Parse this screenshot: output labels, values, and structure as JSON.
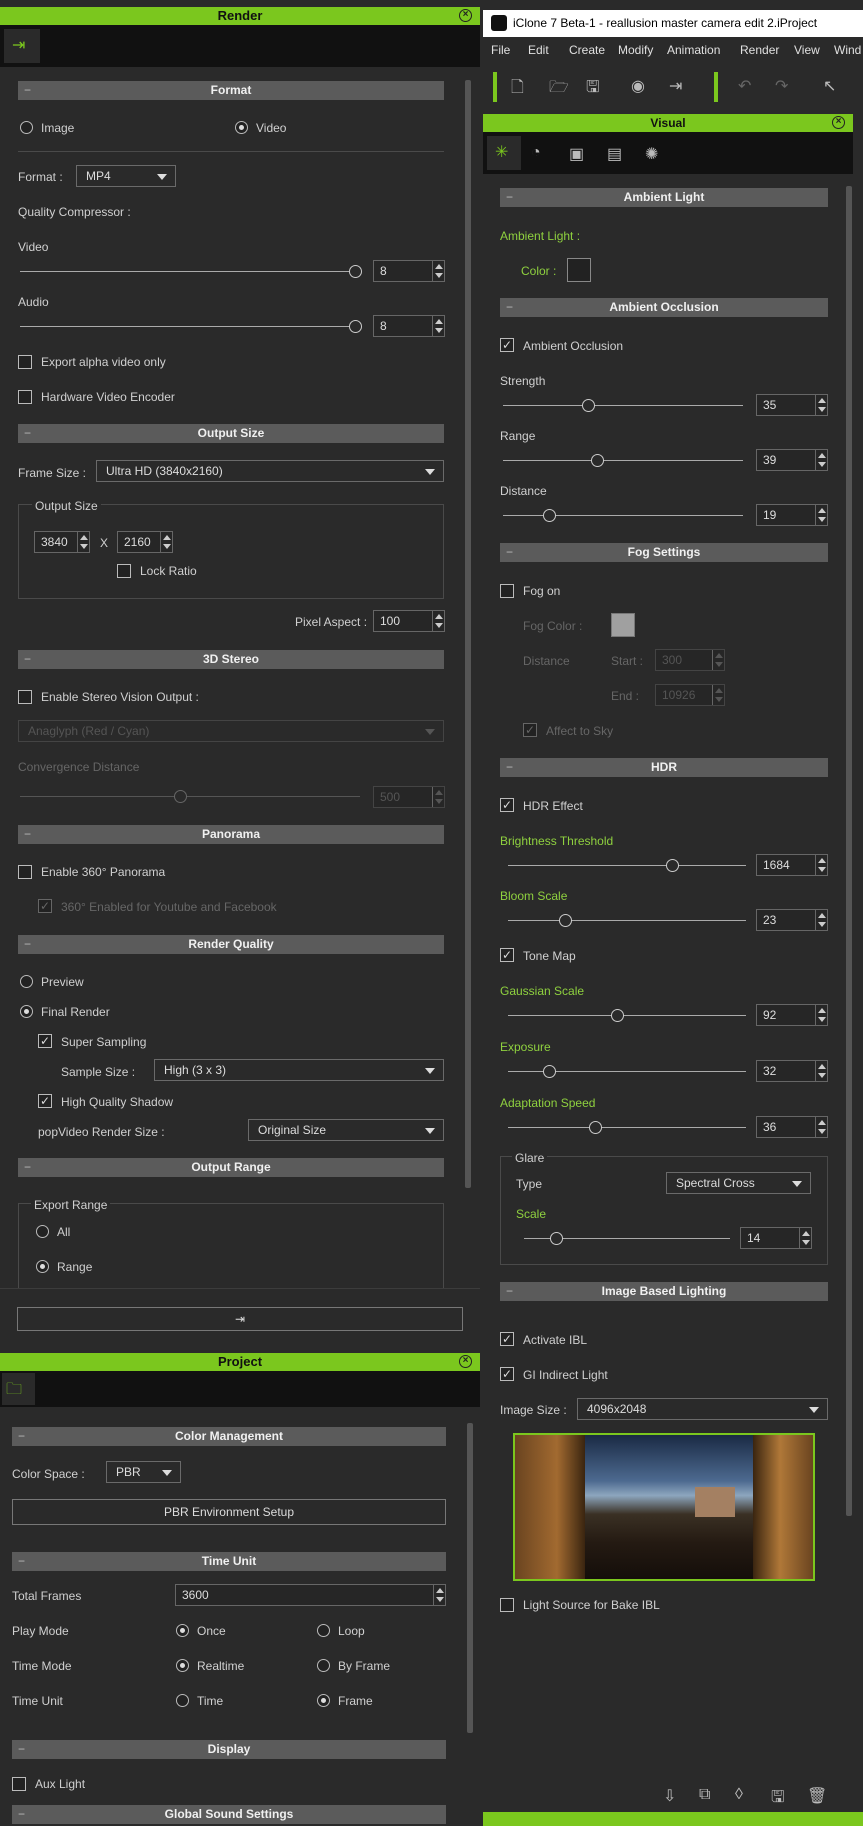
{
  "render": {
    "title": "Render",
    "format_section": "Format",
    "image_label": "Image",
    "video_label": "Video",
    "format_label": "Format :",
    "format_value": "MP4",
    "quality_label": "Quality Compressor :",
    "video_quality_label": "Video",
    "video_quality_value": "8",
    "audio_quality_label": "Audio",
    "audio_quality_value": "8",
    "export_alpha_label": "Export alpha video only",
    "hw_encoder_label": "Hardware Video Encoder",
    "output_size_section": "Output Size",
    "frame_size_label": "Frame Size :",
    "frame_size_value": "Ultra HD (3840x2160)",
    "output_size_group": "Output Size",
    "width_value": "3840",
    "x_label": "X",
    "height_value": "2160",
    "lock_ratio_label": "Lock Ratio",
    "pixel_aspect_label": "Pixel Aspect :",
    "pixel_aspect_value": "100",
    "stereo_section": "3D Stereo",
    "enable_stereo_label": "Enable Stereo Vision Output :",
    "anaglyph_value": "Anaglyph (Red / Cyan)",
    "convergence_label": "Convergence Distance",
    "convergence_value": "500",
    "panorama_section": "Panorama",
    "enable_360_label": "Enable 360° Panorama",
    "youtube_label": "360° Enabled for Youtube and Facebook",
    "render_quality_section": "Render Quality",
    "preview_label": "Preview",
    "final_render_label": "Final Render",
    "super_sampling_label": "Super Sampling",
    "sample_size_label": "Sample Size :",
    "sample_size_value": "High (3 x 3)",
    "hq_shadow_label": "High Quality Shadow",
    "popvideo_label": "popVideo Render Size :",
    "popvideo_value": "Original Size",
    "output_range_section": "Output Range",
    "export_range_group": "Export Range",
    "all_label": "All",
    "range_label": "Range",
    "render_button_icon": "⇥"
  },
  "project": {
    "title": "Project",
    "color_mgmt_section": "Color Management",
    "color_space_label": "Color Space :",
    "color_space_value": "PBR",
    "pbr_env_button": "PBR Environment Setup",
    "time_unit_section": "Time Unit",
    "total_frames_label": "Total Frames",
    "total_frames_value": "3600",
    "play_mode_label": "Play Mode",
    "once_label": "Once",
    "loop_label": "Loop",
    "time_mode_label": "Time Mode",
    "realtime_label": "Realtime",
    "by_frame_label": "By Frame",
    "time_unit_label": "Time Unit",
    "time_label": "Time",
    "frame_label": "Frame",
    "display_section": "Display",
    "aux_light_label": "Aux Light",
    "global_sound_section": "Global Sound Settings"
  },
  "app": {
    "window_title": "iClone 7 Beta-1 - reallusion master camera edit 2.iProject",
    "menu": [
      "File",
      "Edit",
      "Create",
      "Modify",
      "Animation",
      "Render",
      "View",
      "Wind"
    ]
  },
  "visual": {
    "title": "Visual",
    "ambient_light_section": "Ambient Light",
    "ambient_light_label": "Ambient Light :",
    "color_label": "Color :",
    "ao_section": "Ambient Occlusion",
    "ao_label": "Ambient Occlusion",
    "strength_label": "Strength",
    "strength_value": "35",
    "range_label": "Range",
    "range_value": "39",
    "distance_label": "Distance",
    "distance_value": "19",
    "fog_section": "Fog Settings",
    "fog_on_label": "Fog on",
    "fog_color_label": "Fog Color :",
    "fog_distance_label": "Distance",
    "start_label": "Start :",
    "start_value": "300",
    "end_label": "End :",
    "end_value": "10926",
    "affect_sky_label": "Affect to Sky",
    "hdr_section": "HDR",
    "hdr_effect_label": "HDR Effect",
    "brightness_label": "Brightness Threshold",
    "brightness_value": "1684",
    "bloom_label": "Bloom Scale",
    "bloom_value": "23",
    "tone_map_label": "Tone Map",
    "gaussian_label": "Gaussian Scale",
    "gaussian_value": "92",
    "exposure_label": "Exposure",
    "exposure_value": "32",
    "adaptation_label": "Adaptation Speed",
    "adaptation_value": "36",
    "glare_group": "Glare",
    "type_label": "Type",
    "type_value": "Spectral Cross",
    "scale_label": "Scale",
    "scale_value": "14",
    "ibl_section": "Image Based Lighting",
    "activate_ibl_label": "Activate IBL",
    "gi_label": "GI Indirect Light",
    "image_size_label": "Image Size :",
    "image_size_value": "4096x2048",
    "light_source_label": "Light Source for Bake IBL"
  },
  "colors": {
    "accent": "#7bc71e",
    "panel": "#2a2a2a",
    "section": "#5b5b5b"
  }
}
